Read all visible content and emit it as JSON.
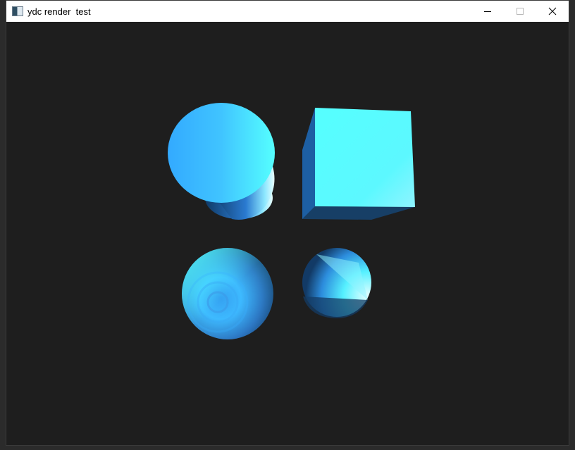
{
  "window": {
    "title": "ydc render  test",
    "icon": "app-window-icon",
    "controls": [
      "minimize-icon",
      "maximize-icon",
      "close-icon"
    ]
  },
  "scene": {
    "background": "#1e1e1e",
    "accent": "#55ffff",
    "objects": [
      "cylinder",
      "cube",
      "sphere",
      "cone"
    ]
  }
}
